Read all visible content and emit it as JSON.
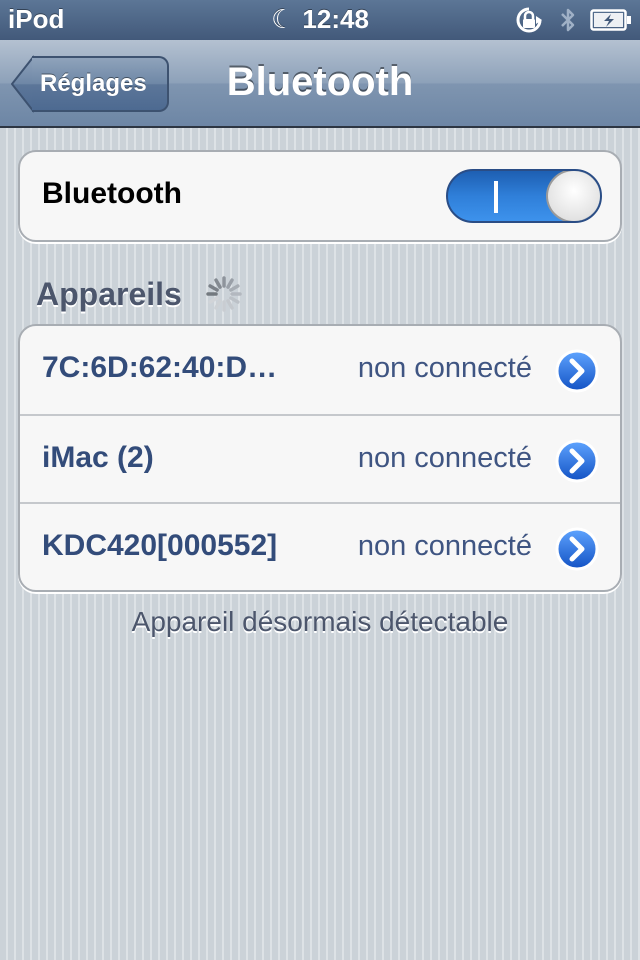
{
  "status_bar": {
    "carrier": "iPod",
    "time": "12:48",
    "icons": [
      "moon-icon",
      "rotation-lock-icon",
      "bluetooth-icon",
      "battery-charging-icon"
    ]
  },
  "nav": {
    "back_label": "Réglages",
    "title": "Bluetooth"
  },
  "bluetooth": {
    "label": "Bluetooth",
    "enabled": true,
    "toggle_on_mark": "I"
  },
  "devices_section": {
    "title": "Appareils",
    "searching": true
  },
  "devices": [
    {
      "name": "7C:6D:62:40:D…",
      "status": "non connecté"
    },
    {
      "name": "iMac (2)",
      "status": "non connecté"
    },
    {
      "name": "KDC420[000552]",
      "status": "non connecté"
    }
  ],
  "footer": "Appareil désormais détectable",
  "colors": {
    "accent_blue": "#2f7fd9",
    "device_text": "#334c7a",
    "nav_bar": "#7f95b0"
  }
}
